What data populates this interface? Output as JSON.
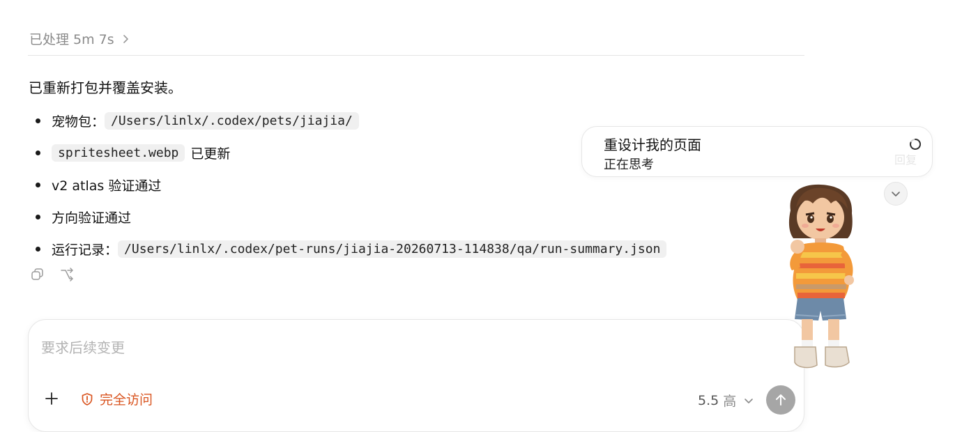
{
  "header": {
    "processed_label": "已处理 5m 7s"
  },
  "message": {
    "headline": "已重新打包并覆盖安装。",
    "items": [
      {
        "label": "宠物包：",
        "code": "/Users/linlx/.codex/pets/jiajia/"
      },
      {
        "code": "spritesheet.webp",
        "label": "已更新"
      },
      {
        "label": "v2 atlas 验证通过"
      },
      {
        "label": "方向验证通过"
      },
      {
        "label": "运行记录：",
        "code": "/Users/linlx/.codex/pet-runs/jiajia-20260713-114838/qa/run-summary.json"
      }
    ]
  },
  "actions": {
    "copy_icon": "copy-icon",
    "share_icon": "branch-icon"
  },
  "composer": {
    "placeholder": "要求后续变更",
    "access_label": "完全访问",
    "model_version": "5.5",
    "model_level": "高",
    "accent_color": "#d9531e"
  },
  "task_card": {
    "title": "重设计我的页面",
    "status": "正在思考",
    "ghost_text": "回复"
  },
  "colors": {
    "send_button": "#a6a6a6",
    "divider": "#e4e4e4"
  }
}
